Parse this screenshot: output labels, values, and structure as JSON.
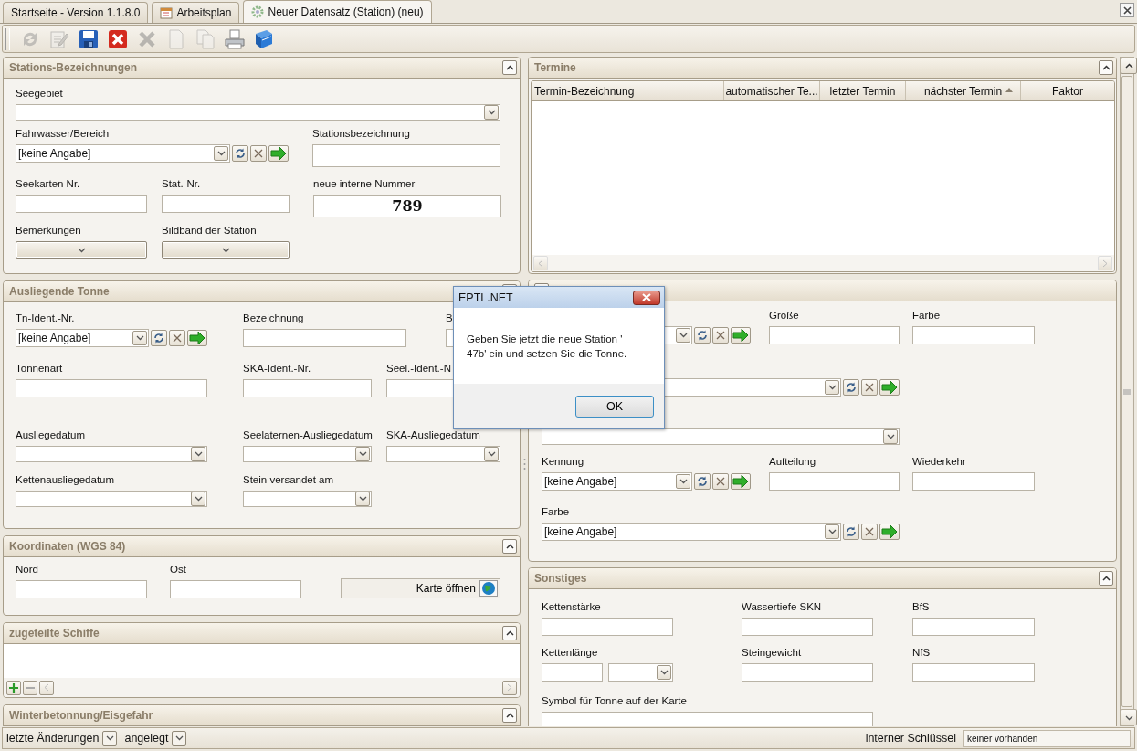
{
  "tabs": [
    {
      "label": "Startseite - Version 1.1.8.0",
      "kind": "plain",
      "selected": false
    },
    {
      "label": "Arbeitsplan",
      "kind": "calendar",
      "selected": false
    },
    {
      "label": "Neuer Datensatz (Station) (neu)",
      "kind": "record",
      "selected": true
    }
  ],
  "toolbar": [
    {
      "kind": "refresh",
      "disabled": true
    },
    {
      "kind": "edit",
      "disabled": true
    },
    {
      "kind": "save",
      "disabled": false
    },
    {
      "kind": "delete",
      "disabled": false
    },
    {
      "kind": "cancel",
      "disabled": true
    },
    {
      "kind": "new",
      "disabled": true
    },
    {
      "kind": "copy",
      "disabled": true
    },
    {
      "kind": "print",
      "disabled": false
    },
    {
      "kind": "book",
      "disabled": false
    }
  ],
  "left_panels": [
    {
      "kind": "form",
      "title": "Stations-Bezeichnungen",
      "expanded": true,
      "rows": [
        [
          {
            "label": "Seegebiet",
            "kind": "combo"
          }
        ],
        [
          {
            "label": "Fahrwasser/Bereich",
            "kind": "combo_tools",
            "value": "[keine Angabe]"
          },
          "",
          {
            "label": "Stationsbezeichnung",
            "kind": "text"
          }
        ],
        [
          {
            "label": "Seekarten Nr.",
            "kind": "text"
          },
          {
            "label": "Stat.-Nr.",
            "kind": "text"
          },
          {
            "label": "neue interne Nummer",
            "kind": "number",
            "value": "789"
          }
        ],
        [
          {
            "label": "Bemerkungen",
            "kind": "dropdown"
          },
          {
            "label": "Bildband der Station",
            "kind": "dropdown"
          }
        ]
      ]
    },
    {
      "kind": "form",
      "title": "Ausliegende Tonne",
      "rows": [
        [
          {
            "label": "Tn-Ident.-Nr.",
            "kind": "combo_tools",
            "value": "[keine Angabe]"
          },
          {
            "label": "Bezeichnung",
            "kind": "text"
          },
          {
            "label": "B",
            "kind": "text"
          }
        ],
        [
          {
            "label": "Tonnenart",
            "kind": "text"
          },
          {
            "label": "SKA-Ident.-Nr.",
            "kind": "text"
          },
          {
            "label": "Seel.-Ident.-N",
            "kind": "text"
          }
        ],
        [
          {
            "label": "Ausliegedatum",
            "kind": "combo"
          },
          {
            "label": "Seelaternen-Ausliegedatum",
            "kind": "combo"
          },
          {
            "label": "SKA-Ausliegedatum",
            "kind": "combo"
          }
        ],
        [
          {
            "label": "Kettenausliegedatum",
            "kind": "combo"
          },
          {
            "label": "Stein versandet am",
            "kind": "combo"
          }
        ]
      ]
    },
    {
      "kind": "form",
      "title": "Koordinaten (WGS 84)",
      "expanded": true,
      "rows": [
        [
          {
            "label": "Nord",
            "kind": "text"
          },
          {
            "label": "Ost",
            "kind": "text"
          },
          {
            "kind": "map_button",
            "text": "Karte öffnen"
          }
        ]
      ]
    },
    {
      "kind": "list",
      "title": "zugeteilte Schiffe",
      "expanded": true
    },
    {
      "kind": "header",
      "title": "Winterbetonnung/Eisgefahr",
      "expanded": true
    }
  ],
  "right_panels": [
    {
      "kind": "table",
      "title": "Termine",
      "expanded": true,
      "columns": [
        {
          "label": "Termin-Bezeichnung",
          "sorted": false
        },
        {
          "label": "automatischer Te...",
          "sorted": false
        },
        {
          "label": "letzter Termin",
          "sorted": false
        },
        {
          "label": "nächster Termin",
          "sorted": true
        },
        {
          "label": "Faktor",
          "sorted": false
        }
      ]
    },
    {
      "kind": "form",
      "rows": [
        [
          {
            "kind": "combo_tools"
          },
          {
            "label": "Größe",
            "kind": "text"
          },
          {
            "label": "Farbe",
            "kind": "text"
          }
        ],
        [
          {
            "kind": "combo_tools"
          }
        ],
        [
          {
            "kind": "combo"
          }
        ],
        [
          {
            "label": "Kennung",
            "kind": "combo_tools",
            "value": "[keine Angabe]"
          },
          {
            "label": "Aufteilung",
            "kind": "text"
          },
          {
            "label": "Wiederkehr",
            "kind": "text"
          }
        ],
        [
          {
            "label": "Farbe",
            "kind": "combo_tools",
            "value": "[keine Angabe]"
          }
        ]
      ]
    },
    {
      "kind": "form",
      "title": "Sonstiges",
      "expanded": true,
      "rows": [
        [
          {
            "label": "Kettenstärke",
            "kind": "text"
          },
          {
            "label": "Wassertiefe SKN",
            "kind": "text"
          },
          {
            "label": "BfS",
            "kind": "text"
          }
        ],
        [
          {
            "label": "Kettenlänge",
            "kind": "text_combo"
          },
          {
            "label": "Steingewicht",
            "kind": "text"
          },
          {
            "label": "NfS",
            "kind": "text"
          }
        ],
        [
          {
            "label": "Symbol für Tonne auf der Karte",
            "kind": "text"
          }
        ]
      ]
    }
  ],
  "status_bar": {
    "items": [
      {
        "label": "letzte Änderungen"
      },
      {
        "label": "angelegt"
      }
    ],
    "key_label": "interner Schlüssel",
    "key_value": "keiner vorhanden"
  },
  "dialog": {
    "title": "EPTL.NET",
    "message": "Geben Sie jetzt die neue Station '\n47b' ein und setzen Sie die Tonne.",
    "button": "OK"
  }
}
